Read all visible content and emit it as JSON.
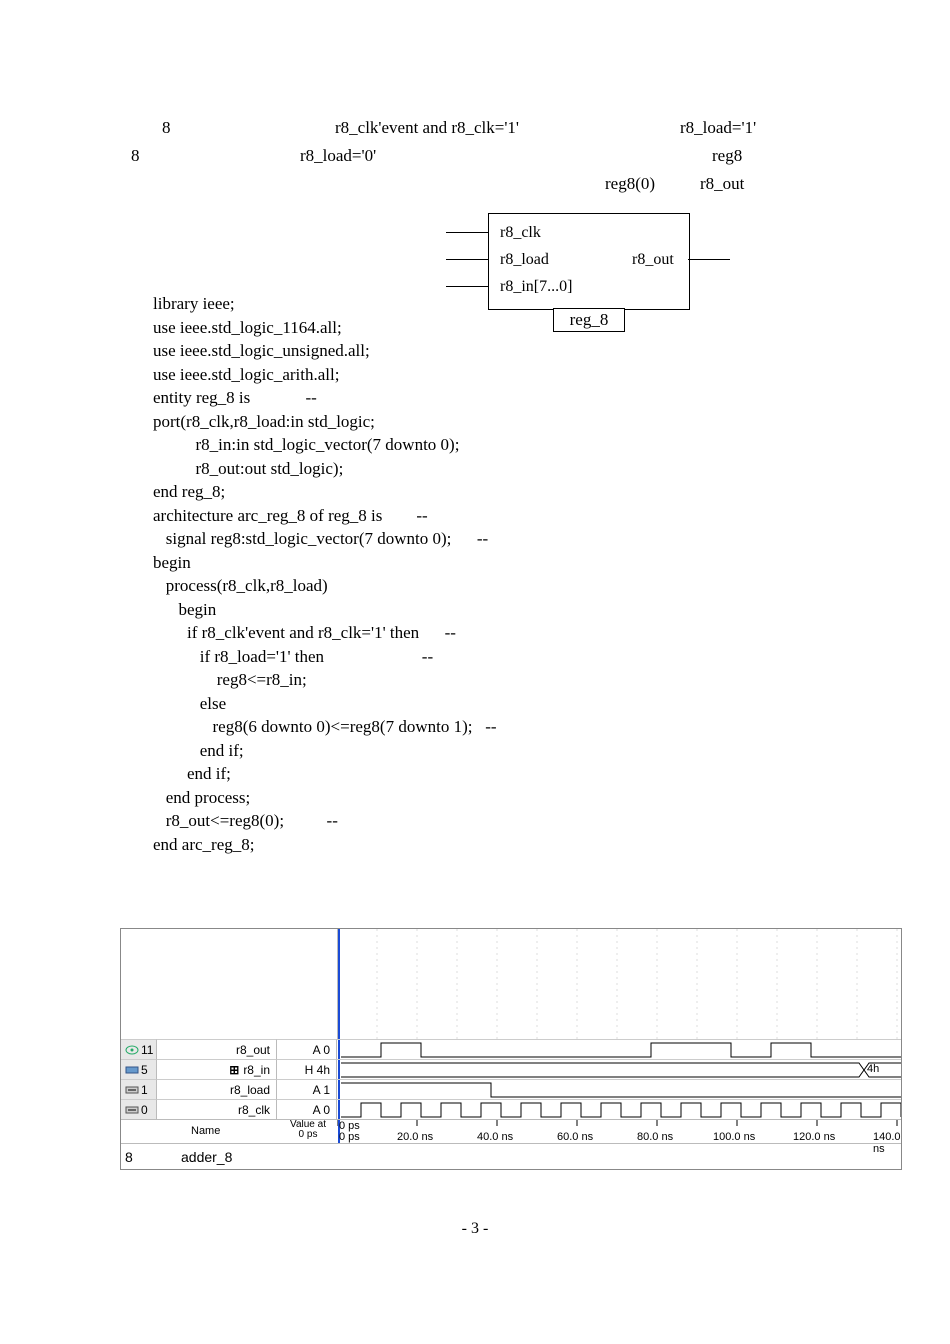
{
  "top": {
    "row1_a": "8",
    "row1_b": "r8_clk'event and r8_clk='1'",
    "row1_c": "r8_load='1'",
    "row2_a": "8",
    "row2_b": "r8_load='0'",
    "row2_c": "reg8",
    "row3_a": "reg8(0)",
    "row3_b": "r8_out"
  },
  "diagram": {
    "in1": "r8_clk",
    "in2": "r8_load",
    "in3": "r8_in[7...0]",
    "out": "r8_out",
    "name": "reg_8"
  },
  "code": [
    "library ieee;",
    "use ieee.std_logic_1164.all;",
    "use ieee.std_logic_unsigned.all;",
    "use ieee.std_logic_arith.all;",
    "entity reg_8 is             --",
    "port(r8_clk,r8_load:in std_logic;",
    "          r8_in:in std_logic_vector(7 downto 0);",
    "          r8_out:out std_logic);",
    "end reg_8;",
    "",
    "architecture arc_reg_8 of reg_8 is        --",
    "   signal reg8:std_logic_vector(7 downto 0);      --",
    "begin",
    "   process(r8_clk,r8_load)",
    "      begin",
    "        if r8_clk'event and r8_clk='1' then      --",
    "           if r8_load='1' then                       --",
    "               reg8<=r8_in;",
    "           else",
    "              reg8(6 downto 0)<=reg8(7 downto 1);   --",
    "           end if;",
    "        end if;",
    "   end process;",
    "   r8_out<=reg8(0);          --",
    "end arc_reg_8;"
  ],
  "wave": {
    "rows": [
      {
        "idx": "11",
        "name": "r8_out",
        "value": "A 0"
      },
      {
        "idx": "5",
        "name": "r8_in",
        "value": "H 4h",
        "bus": true
      },
      {
        "idx": "1",
        "name": "r8_load",
        "value": "A 1"
      },
      {
        "idx": "0",
        "name": "r8_clk",
        "value": "A 0"
      }
    ],
    "name_header": "Name",
    "value_header1": "Value at",
    "value_header2": "0 ps",
    "axis_top": "0 ps",
    "axis_bot": "0 ps",
    "ticks": [
      "20.0 ns",
      "40.0 ns",
      "60.0 ns",
      "80.0 ns",
      "100.0 ns",
      "120.0 ns",
      "140.0 ns"
    ],
    "bus_label": "4h"
  },
  "footer": {
    "left_num": "8",
    "label": "adder_8"
  },
  "page_number": "- 3 -"
}
